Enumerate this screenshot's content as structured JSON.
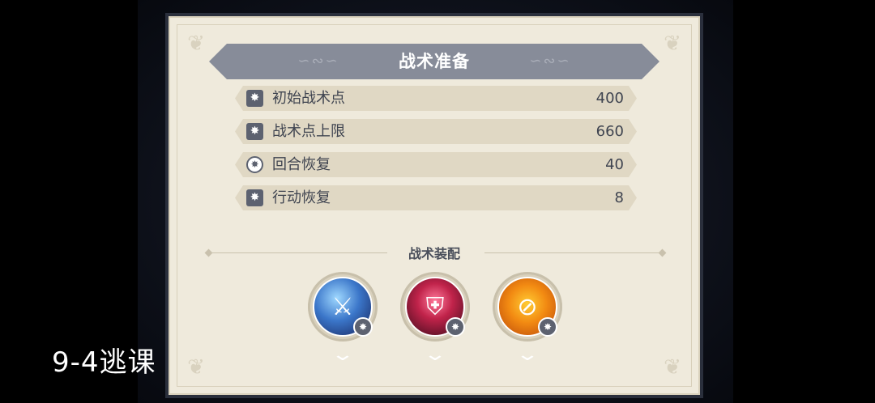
{
  "panel": {
    "title": "战术准备",
    "stats": [
      {
        "label": "初始战术点",
        "value": "400",
        "icon": "tactic-point-icon"
      },
      {
        "label": "战术点上限",
        "value": "660",
        "icon": "tactic-point-icon"
      },
      {
        "label": "回合恢复",
        "value": "40",
        "icon": "round-recover-icon"
      },
      {
        "label": "行动恢复",
        "value": "8",
        "icon": "tactic-point-icon"
      }
    ],
    "section_title": "战术装配",
    "skills": [
      {
        "icon": "dash-figures-skill-icon"
      },
      {
        "icon": "shield-burst-skill-icon"
      },
      {
        "icon": "slash-strike-skill-icon"
      }
    ]
  },
  "overlay": {
    "label": "9-4逃课"
  },
  "colors": {
    "panel_bg": "#efeadc",
    "banner": "#878c99",
    "row_bg": "#e0d8c4",
    "text": "#3f4450"
  }
}
